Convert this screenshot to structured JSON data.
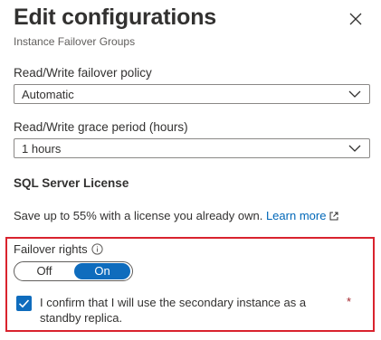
{
  "header": {
    "title": "Edit configurations",
    "subtitle": "Instance Failover Groups"
  },
  "failover_policy": {
    "label": "Read/Write failover policy",
    "value": "Automatic"
  },
  "grace_period": {
    "label": "Read/Write grace period (hours)",
    "value": "1 hours"
  },
  "license": {
    "heading": "SQL Server License",
    "text": "Save up to 55% with a license you already own. ",
    "link": "Learn more"
  },
  "failover_rights": {
    "label": "Failover rights",
    "off_label": "Off",
    "on_label": "On",
    "selected": "On",
    "confirm_checked": true,
    "confirm_text": "I confirm that I will use the secondary instance as a standby replica.",
    "required_marker": "*"
  },
  "icons": {
    "close": "close-icon",
    "dropdown": "chevron-down-icon",
    "external": "external-link-icon",
    "info": "info-icon",
    "check": "checkmark-icon"
  },
  "colors": {
    "accent": "#0f6cbd",
    "link": "#0067b8",
    "highlight_border": "#d9232e",
    "required": "#a4262c"
  }
}
